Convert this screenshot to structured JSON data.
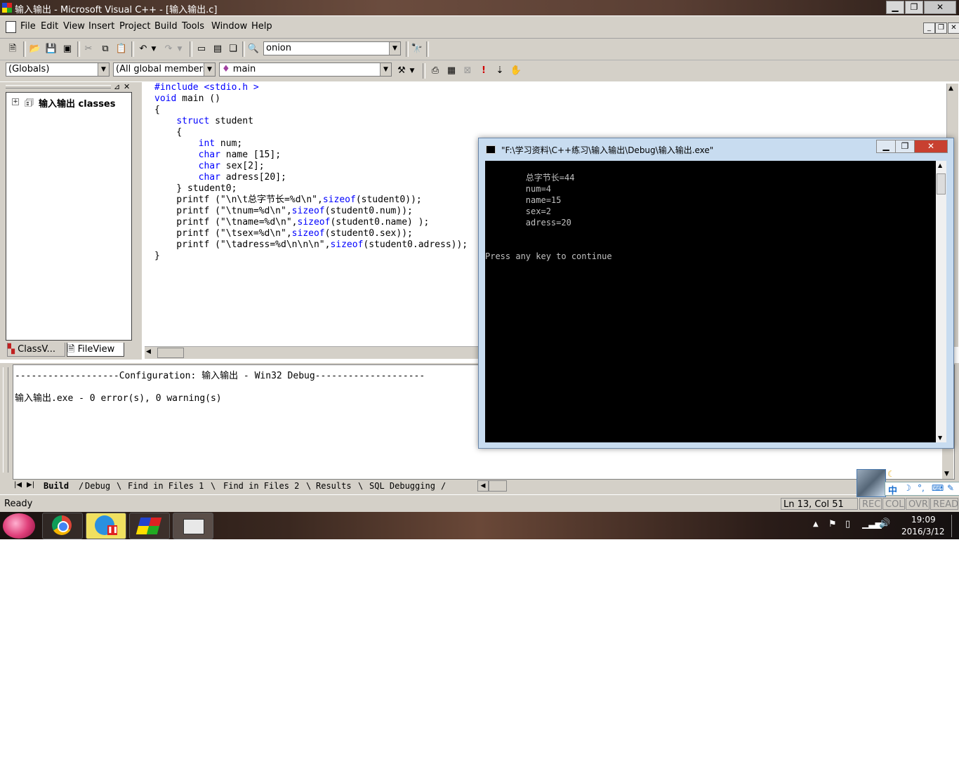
{
  "window": {
    "title": "输入输出 - Microsoft Visual C++ - [输入输出.c]",
    "min": "▁",
    "max": "❐",
    "close": "✕"
  },
  "menu": {
    "items": [
      "File",
      "Edit",
      "View",
      "Insert",
      "Project",
      "Build",
      "Tools",
      "Window",
      "Help"
    ]
  },
  "toolbar": {
    "find_combo": "onion"
  },
  "wizardbar": {
    "scope": "(Globals)",
    "members": "(All global members",
    "function": "main"
  },
  "workspace": {
    "tree_root": "输入输出 classes",
    "tab_class": "ClassV...",
    "tab_file": "FileView"
  },
  "editor": {
    "lines": [
      "#include <stdio.h >",
      "void main ()",
      "{",
      "    struct student",
      "    {",
      "        int num;",
      "        char name [15];",
      "        char sex[2];",
      "        char adress[20];",
      "    } student0;",
      "    printf (\"\\n\\t总字节长=%d\\n\",sizeof(student0));",
      "    printf (\"\\tnum=%d\\n\",sizeof(student0.num));",
      "    printf (\"\\tname=%d\\n\",sizeof(student0.name) );",
      "    printf (\"\\tsex=%d\\n\",sizeof(student0.sex));",
      "    printf (\"\\tadress=%d\\n\\n\\n\",sizeof(student0.adress));",
      "}"
    ]
  },
  "output": {
    "line1": "-------------------Configuration: 输入输出 - Win32 Debug--------------------",
    "line2": "输入输出.exe - 0 error(s), 0 warning(s)",
    "tabs": [
      "Build",
      "Debug",
      "Find in Files 1",
      "Find in Files 2",
      "Results",
      "SQL Debugging"
    ]
  },
  "status": {
    "text": "Ready",
    "position": "Ln 13, Col 51",
    "rec": "REC",
    "col": "COL",
    "ovr": "OVR",
    "read": "READ"
  },
  "console": {
    "title": "\"F:\\学习资料\\C++练习\\输入输出\\Debug\\输入输出.exe\"",
    "lines": [
      "",
      "        总字节长=44",
      "        num=4",
      "        name=15",
      "        sex=2",
      "        adress=20",
      "",
      "",
      "Press any key to continue"
    ]
  },
  "ime": {
    "mode": "中"
  },
  "taskbar": {
    "time": "19:09",
    "date": "2016/3/12"
  }
}
